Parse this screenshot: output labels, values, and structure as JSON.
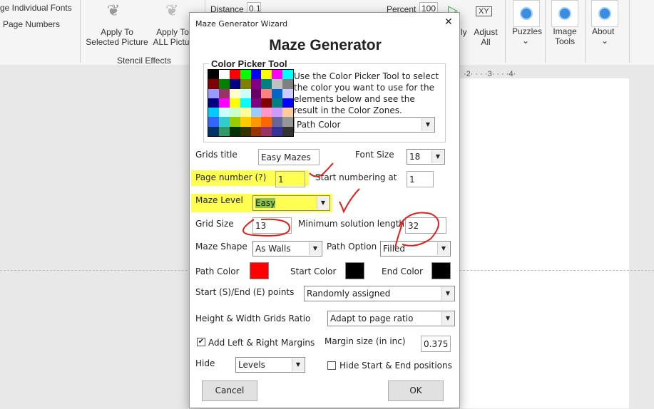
{
  "ribbon": {
    "change_fonts": "ge Individual Fonts",
    "page_numbers": "Page Numbers",
    "apply_selected": "Apply To\nSelected Picture",
    "apply_selected_l1": "Apply To",
    "apply_selected_l2": "Selected Picture",
    "apply_all_l1": "Apply To",
    "apply_all_l2": "ALL Pictur",
    "group_stencil": "Stencil Effects",
    "distance_label": "Distance",
    "distance_value": "0.1",
    "percent_label": "Percent",
    "percent_value": "100",
    "apply_partial": "ly",
    "adjust_all_l1": "Adjust",
    "adjust_all_l2": "All",
    "xy": "XY",
    "puzzles": "Puzzles",
    "image_tools_l1": "Image",
    "image_tools_l2": "Tools",
    "about": "About",
    "chev": "⌄"
  },
  "ruler": "·2· · · ·3· · · ·4·",
  "dialog": {
    "title": "Maze Generator Wizard",
    "close": "✕",
    "heading": "Maze Generator",
    "color_picker": {
      "legend": "Color Picker Tool",
      "description": "Use the Color Picker Tool to select the color you want to use for the elements below and see the result in the Color Zones.",
      "target": "Path Color",
      "palette": [
        "#000000",
        "#ffffff",
        "#ff0000",
        "#00ff00",
        "#0000ff",
        "#ffff00",
        "#ff00ff",
        "#00ffff",
        "#800000",
        "#008000",
        "#000080",
        "#808000",
        "#800080",
        "#008080",
        "#c0c0c0",
        "#808080",
        "#9999ff",
        "#993366",
        "#ffffcc",
        "#ccffff",
        "#660066",
        "#ff8080",
        "#0066cc",
        "#ccccff",
        "#000080",
        "#ff00ff",
        "#ffff00",
        "#00ffff",
        "#800080",
        "#800000",
        "#008080",
        "#0000ff",
        "#00ccff",
        "#ccffff",
        "#ccffcc",
        "#ffff99",
        "#99ccff",
        "#ff99cc",
        "#cc99ff",
        "#ffcc99",
        "#3366ff",
        "#33cccc",
        "#99cc00",
        "#ffcc00",
        "#ff9900",
        "#ff6600",
        "#666699",
        "#969696",
        "#003366",
        "#339966",
        "#003300",
        "#333300",
        "#993300",
        "#993366",
        "#333399",
        "#333333"
      ]
    },
    "grids_title": {
      "label": "Grids title",
      "value": "Easy Mazes"
    },
    "font_size": {
      "label": "Font Size",
      "value": "18"
    },
    "page_number": {
      "label": "Page number (?)",
      "value": "1"
    },
    "start_numbering": {
      "label": "Start numbering at",
      "value": "1"
    },
    "maze_level": {
      "label": "Maze Level",
      "value": "Easy"
    },
    "grid_size": {
      "label": "Grid Size",
      "value": "13"
    },
    "min_solution": {
      "label": "Minimum solution length",
      "value": "32"
    },
    "maze_shape": {
      "label": "Maze Shape",
      "value": "As Walls"
    },
    "path_option": {
      "label": "Path Option",
      "value": "Filled"
    },
    "path_color": {
      "label": "Path Color",
      "color": "#ff0000"
    },
    "start_color": {
      "label": "Start Color",
      "color": "#000000"
    },
    "end_color": {
      "label": "End Color",
      "color": "#000000"
    },
    "start_end_points": {
      "label": "Start (S)/End (E) points",
      "value": "Randomly assigned"
    },
    "ratio": {
      "label": "Height & Width Grids Ratio",
      "value": "Adapt to page ratio"
    },
    "margins": {
      "label": "Add Left & Right Margins",
      "checked": true,
      "check": "✔"
    },
    "margin_size": {
      "label": "Margin size (in inc)",
      "value": "0.375"
    },
    "hide": {
      "label": "Hide",
      "value": "Levels"
    },
    "hide_start_end": {
      "label": "Hide Start & End positions",
      "checked": false
    },
    "cancel": "Cancel",
    "ok": "OK",
    "arrow": "▼"
  }
}
